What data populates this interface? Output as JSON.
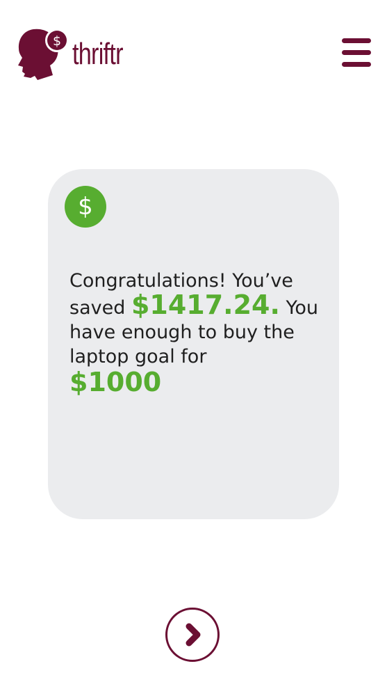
{
  "app": {
    "name": "thriftr"
  },
  "header": {
    "logo_text": "thriftr",
    "logo_icon": "head-with-dollar-coin-icon",
    "menu_icon": "hamburger-menu-icon"
  },
  "card": {
    "icon": "dollar-icon",
    "icon_glyph": "$",
    "message_part1": "Congratulations! You’ve saved ",
    "saved_amount": "$1417.24.",
    "message_part2": " You have enough to buy the laptop goal for",
    "goal_amount": "$1000"
  },
  "navigation": {
    "next_icon": "chevron-right-icon"
  },
  "colors": {
    "brand": "#6b0f33",
    "accent_green": "#57ad30",
    "card_background": "#ebecee",
    "text": "#1f1f1f"
  }
}
